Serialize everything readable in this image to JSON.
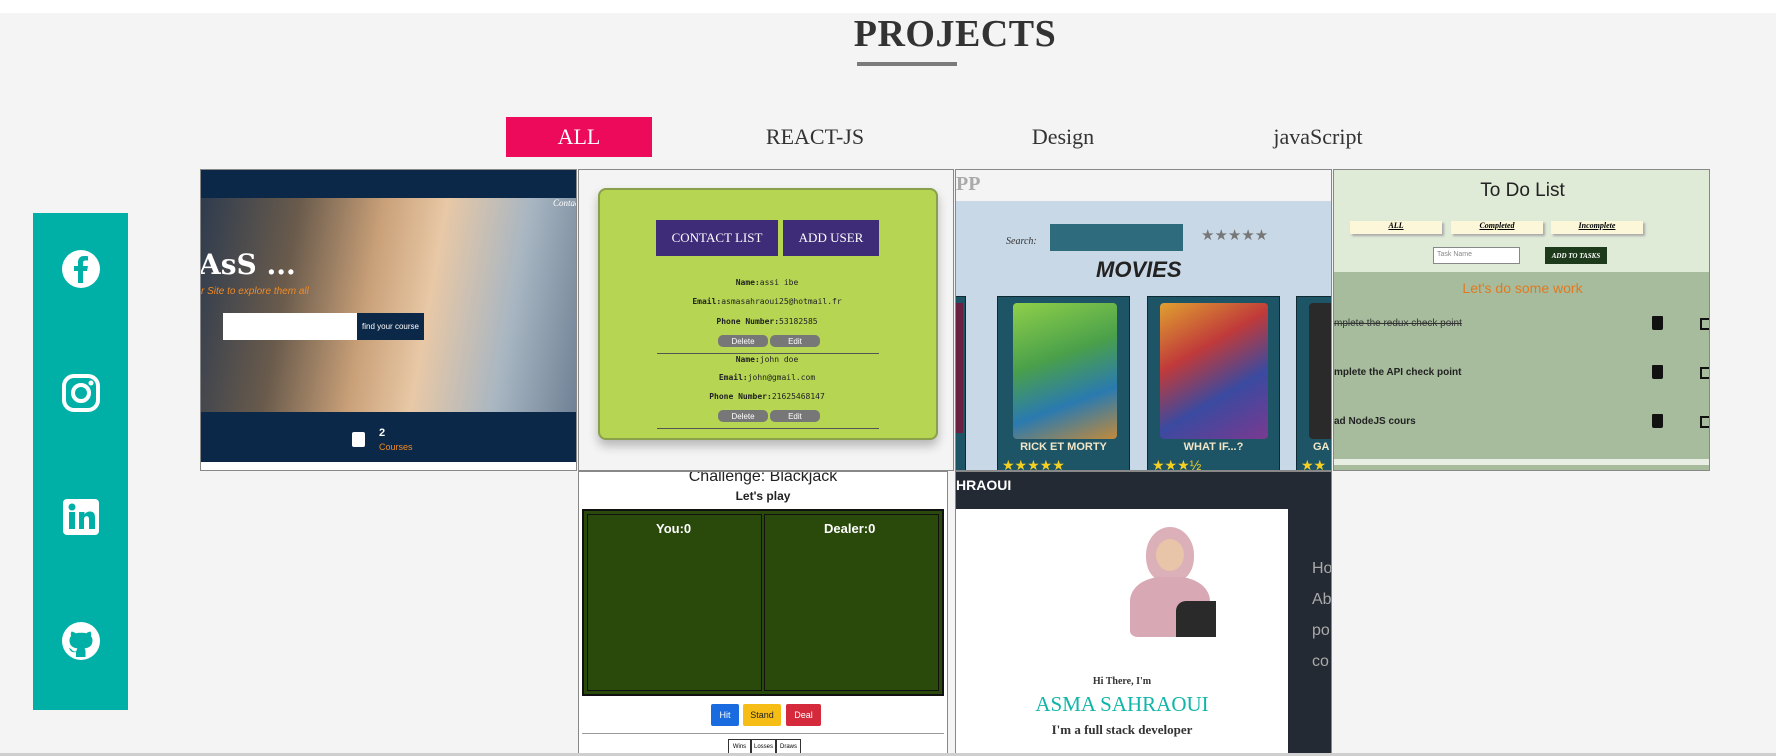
{
  "section": {
    "title": "PROJECTS"
  },
  "filters": [
    {
      "label": "ALL",
      "active": true
    },
    {
      "label": "REACT-JS",
      "active": false
    },
    {
      "label": "Design",
      "active": false
    },
    {
      "label": "javaScript",
      "active": false
    }
  ],
  "social": [
    "facebook-icon",
    "instagram-icon",
    "linkedin-icon",
    "github-icon"
  ],
  "colors": {
    "accent": "#ee0a5a",
    "social_bg": "#00b0a6",
    "title": "#333333"
  },
  "projects": {
    "courses": {
      "nav_link": "Contact",
      "heading": "AsS ...",
      "subtitle": "r Site to explore them all",
      "search_button": "find your course",
      "count": "2",
      "count_label": "Courses"
    },
    "contacts": {
      "btn_list": "CONTACT LIST",
      "btn_add": "ADD USER",
      "entries": [
        {
          "name_label": "Name:",
          "name": "assi ibe",
          "email_label": "Email:",
          "email": "asmasahraoui25@hotmail.fr",
          "phone_label": "Phone Number:",
          "phone": "53182585"
        },
        {
          "name_label": "Name:",
          "name": "john doe",
          "email_label": "Email:",
          "email": "john@gmail.com",
          "phone_label": "Phone Number:",
          "phone": "21625468147"
        }
      ],
      "delete": "Delete",
      "edit": "Edit"
    },
    "movies": {
      "app_fragment": "PP",
      "search_label": "Search:",
      "stars": "★★★★★",
      "heading": "MOVIES",
      "cards": [
        {
          "title": "RICK ET MORTY",
          "rating": "★★★★★"
        },
        {
          "title": "WHAT IF...?",
          "rating": "★★★½"
        },
        {
          "title": "GA",
          "rating": "★★"
        }
      ]
    },
    "todo": {
      "title": "To Do List",
      "filters": [
        "ALL",
        "Completed",
        "Incomplete"
      ],
      "placeholder": "Task Name",
      "add_button": "ADD TO TASKS",
      "subtitle": "Let's do some work",
      "tasks": [
        "mplete the redux check point",
        "mplete the API check point",
        "ad NodeJS cours"
      ]
    },
    "blackjack": {
      "title": "Challenge: Blackjack",
      "subtitle": "Let's play",
      "you": "You:0",
      "dealer": "Dealer:0",
      "hit": "Hit",
      "stand": "Stand",
      "deal": "Deal",
      "stats": [
        "Wins",
        "Losses",
        "Draws"
      ]
    },
    "portfolio": {
      "brand": "HRAOUI",
      "side_links": [
        "Ho",
        "Ab",
        "po",
        "co"
      ],
      "greeting": "Hi There, I'm",
      "name": "ASMA SAHRAOUI",
      "role": "I'm a full stack developer"
    }
  }
}
